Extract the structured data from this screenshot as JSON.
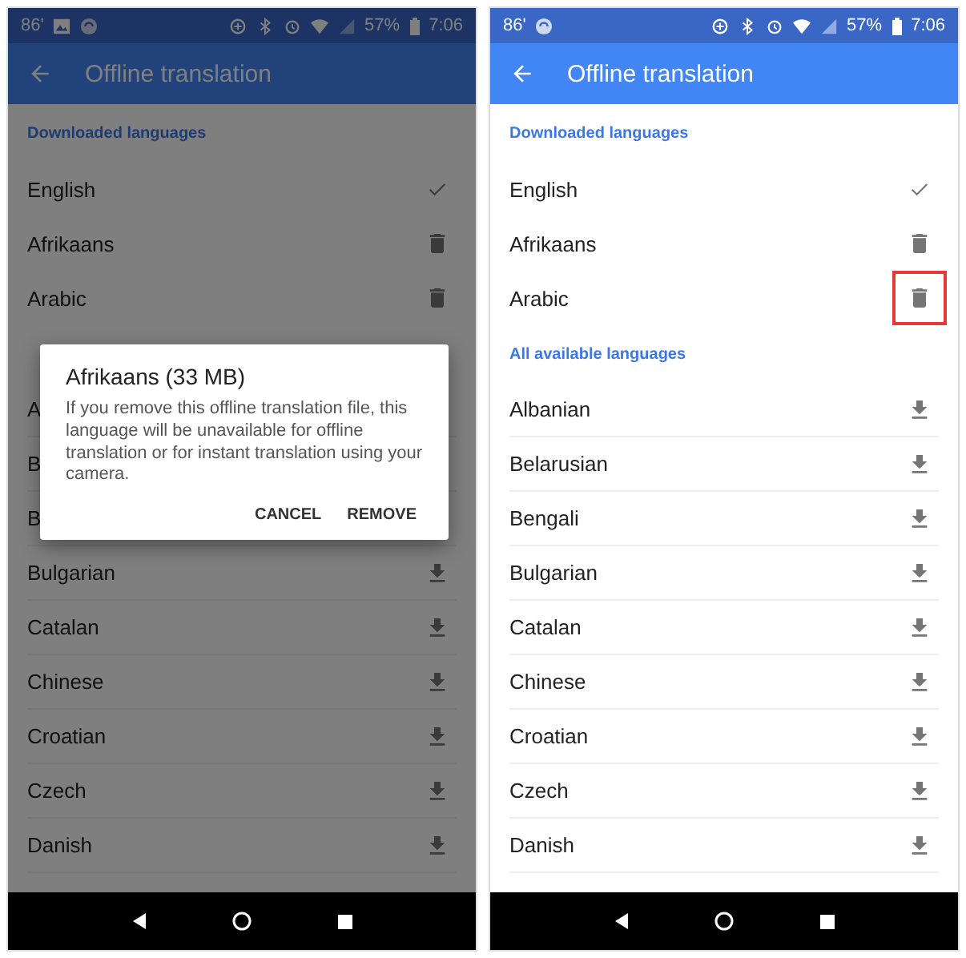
{
  "screens": [
    {
      "dimmed": true,
      "status_bar": {
        "temperature": "86'",
        "image_notification": true,
        "battery": "57%",
        "time": "7:06"
      },
      "app_bar": {
        "title": "Offline translation"
      },
      "sections": [
        {
          "header": "Downloaded languages",
          "rows": [
            {
              "name": "English",
              "kind": "check"
            },
            {
              "name": "Afrikaans",
              "kind": "delete"
            },
            {
              "name": "Arabic",
              "kind": "delete"
            }
          ]
        },
        {
          "rows": [
            {
              "name": "A",
              "kind": "hidden"
            },
            {
              "name": "B",
              "kind": "hidden"
            },
            {
              "name": "B",
              "kind": "hidden"
            },
            {
              "name": "Bulgarian",
              "kind": "download"
            },
            {
              "name": "Catalan",
              "kind": "download"
            },
            {
              "name": "Chinese",
              "kind": "download"
            },
            {
              "name": "Croatian",
              "kind": "download"
            },
            {
              "name": "Czech",
              "kind": "download"
            },
            {
              "name": "Danish",
              "kind": "download"
            }
          ]
        }
      ],
      "dialog": {
        "title": "Afrikaans (33 MB)",
        "message": "If you remove this offline translation file, this language will be unavailable for offline translation or for instant translation using your camera.",
        "buttons": [
          "CANCEL",
          "REMOVE"
        ]
      }
    },
    {
      "dimmed": false,
      "status_bar": {
        "temperature": "86'",
        "image_notification": false,
        "battery": "57%",
        "time": "7:06"
      },
      "app_bar": {
        "title": "Offline translation"
      },
      "sections": [
        {
          "header": "Downloaded languages",
          "rows": [
            {
              "name": "English",
              "kind": "check"
            },
            {
              "name": "Afrikaans",
              "kind": "delete",
              "highlighted": false
            },
            {
              "name": "Arabic",
              "kind": "delete",
              "highlighted": true
            }
          ]
        },
        {
          "header": "All available languages",
          "rows": [
            {
              "name": "Albanian",
              "kind": "download"
            },
            {
              "name": "Belarusian",
              "kind": "download"
            },
            {
              "name": "Bengali",
              "kind": "download"
            },
            {
              "name": "Bulgarian",
              "kind": "download"
            },
            {
              "name": "Catalan",
              "kind": "download"
            },
            {
              "name": "Chinese",
              "kind": "download"
            },
            {
              "name": "Croatian",
              "kind": "download"
            },
            {
              "name": "Czech",
              "kind": "download"
            },
            {
              "name": "Danish",
              "kind": "download"
            }
          ]
        }
      ]
    }
  ]
}
